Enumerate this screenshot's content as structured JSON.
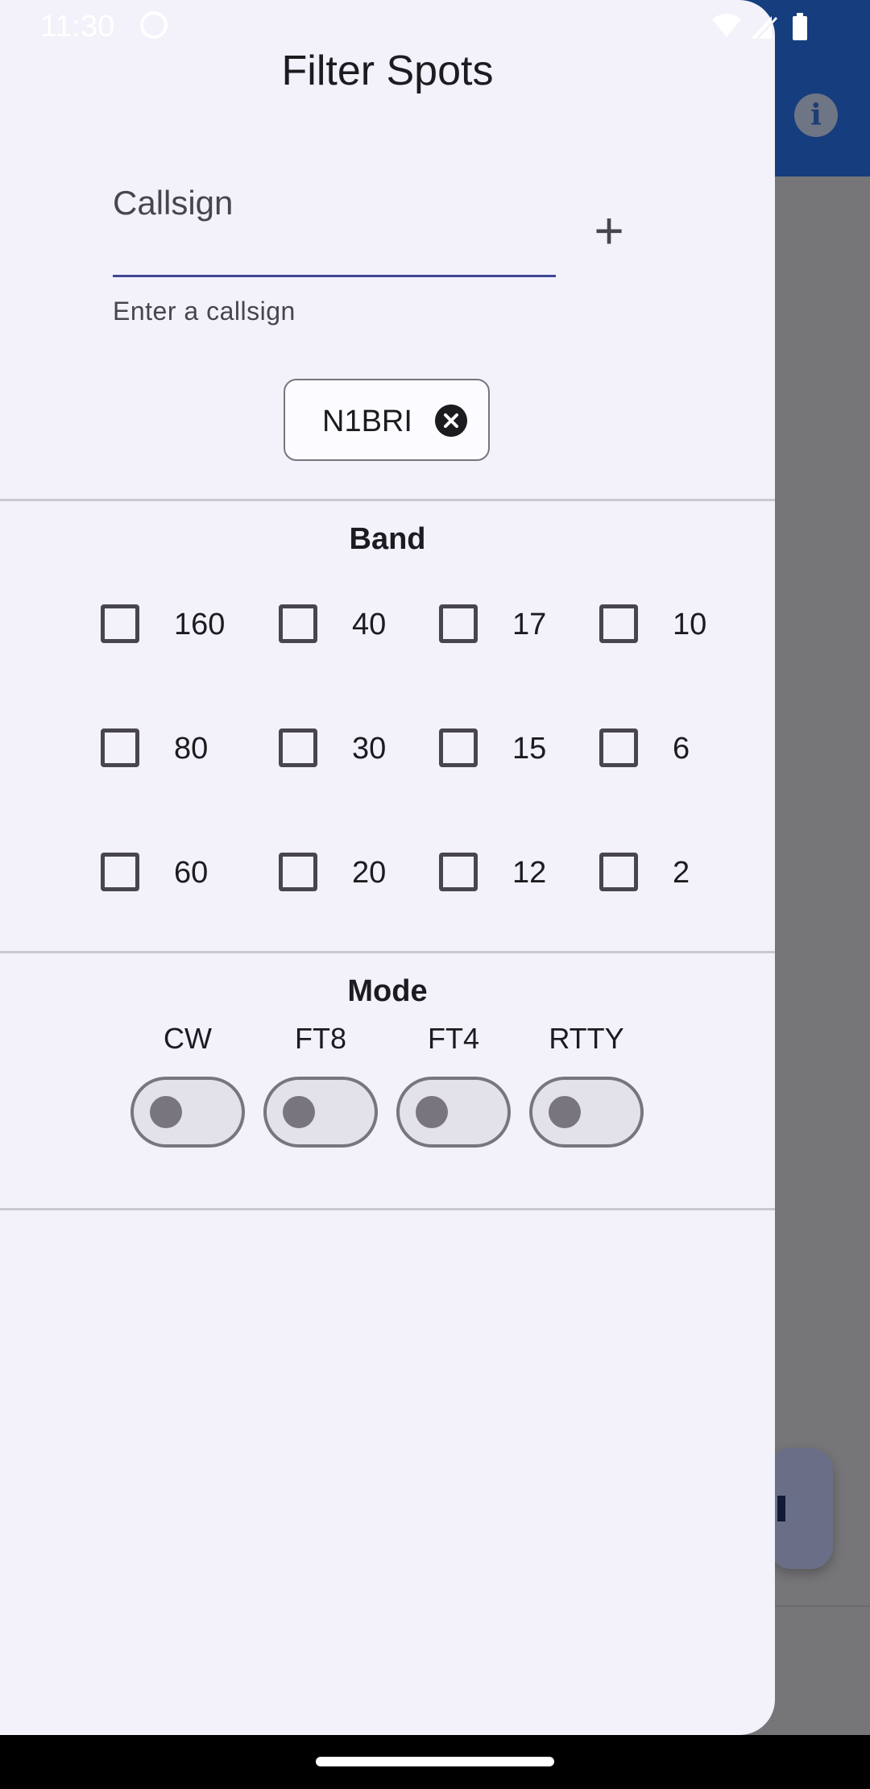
{
  "status_bar": {
    "time": "11:30",
    "icons": [
      "cat-icon",
      "wifi-icon",
      "signal-icon",
      "battery-icon"
    ]
  },
  "background_app": {
    "appbar_color": "#163d7e",
    "info_icon": "info-icon",
    "info_glyph": "i"
  },
  "drawer": {
    "title": "Filter Spots",
    "callsign": {
      "label": "Callsign",
      "value": "",
      "helper": "Enter a callsign",
      "add_icon": "plus-icon",
      "add_glyph": "+"
    },
    "chips": [
      {
        "label": "N1BRI",
        "remove_icon": "close-circle-icon"
      }
    ],
    "band": {
      "heading": "Band",
      "columns": [
        [
          "160",
          "80",
          "60"
        ],
        [
          "40",
          "30",
          "20"
        ],
        [
          "17",
          "15",
          "12"
        ],
        [
          "10",
          "6",
          "2"
        ]
      ],
      "checked": []
    },
    "mode": {
      "heading": "Mode",
      "items": [
        {
          "label": "CW",
          "on": false
        },
        {
          "label": "FT8",
          "on": false
        },
        {
          "label": "FT4",
          "on": false
        },
        {
          "label": "RTTY",
          "on": false
        }
      ]
    }
  },
  "colors": {
    "drawer_bg": "#f3f1f9",
    "accent_underline": "#3f4695",
    "scrim": "#767578"
  }
}
